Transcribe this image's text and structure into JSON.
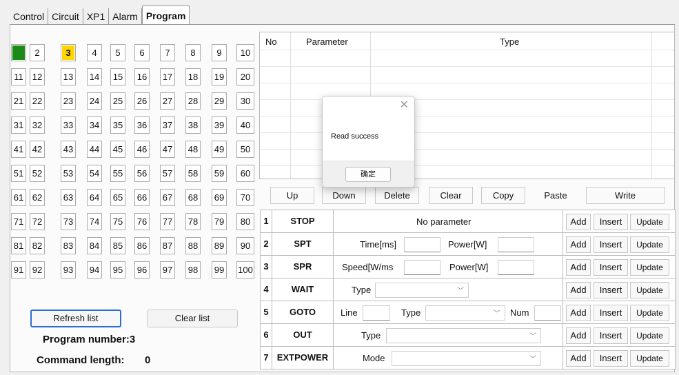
{
  "tabs": [
    {
      "label": "Control"
    },
    {
      "label": "Circuit"
    },
    {
      "label": "XP1"
    },
    {
      "label": "Alarm"
    },
    {
      "label": "Program"
    }
  ],
  "program_grid": {
    "active_green": "1",
    "selected_yellow": "3",
    "items": [
      "1",
      "2",
      "3",
      "4",
      "5",
      "6",
      "7",
      "8",
      "9",
      "10",
      "11",
      "12",
      "13",
      "14",
      "15",
      "16",
      "17",
      "18",
      "19",
      "20",
      "21",
      "22",
      "23",
      "24",
      "25",
      "26",
      "27",
      "28",
      "29",
      "30",
      "31",
      "32",
      "33",
      "34",
      "35",
      "36",
      "37",
      "38",
      "39",
      "40",
      "41",
      "42",
      "43",
      "44",
      "45",
      "46",
      "47",
      "48",
      "49",
      "50",
      "51",
      "52",
      "53",
      "54",
      "55",
      "56",
      "57",
      "58",
      "59",
      "60",
      "61",
      "62",
      "63",
      "64",
      "65",
      "66",
      "67",
      "68",
      "69",
      "70",
      "71",
      "72",
      "73",
      "74",
      "75",
      "76",
      "77",
      "78",
      "79",
      "80",
      "81",
      "82",
      "83",
      "84",
      "85",
      "86",
      "87",
      "88",
      "89",
      "90",
      "91",
      "92",
      "93",
      "94",
      "95",
      "96",
      "97",
      "98",
      "99",
      "100"
    ]
  },
  "left_buttons": {
    "refresh": "Refresh list",
    "clear": "Clear list"
  },
  "program_info": {
    "program_number_label": "Program number:",
    "program_number_value": "3",
    "command_length_label": "Command length:",
    "command_length_value": "0"
  },
  "list_table": {
    "headers": {
      "no": "No",
      "parameter": "Parameter",
      "type": "Type"
    }
  },
  "list_controls": [
    "Up",
    "Down",
    "Delete",
    "Clear",
    "Copy",
    "Paste",
    "Write"
  ],
  "commands": [
    {
      "num": "1",
      "name": "STOP",
      "params": {
        "text": "No parameter"
      }
    },
    {
      "num": "2",
      "name": "SPT",
      "params": {
        "label1": "Time[ms]",
        "label2": "Power[W]"
      }
    },
    {
      "num": "3",
      "name": "SPR",
      "params": {
        "label1": "Speed[W/ms",
        "label2": "Power[W]"
      }
    },
    {
      "num": "4",
      "name": "WAIT",
      "params": {
        "label1": "Type"
      }
    },
    {
      "num": "5",
      "name": "GOTO",
      "params": {
        "label1": "Line",
        "label2": "Type",
        "label3": "Num"
      }
    },
    {
      "num": "6",
      "name": "OUT",
      "params": {
        "label1": "Type"
      }
    },
    {
      "num": "7",
      "name": "EXTPOWER",
      "params": {
        "label1": "Mode"
      }
    }
  ],
  "action_labels": {
    "add": "Add",
    "insert": "Insert",
    "update": "Update"
  },
  "dialog": {
    "message": "Read success",
    "ok": "确定",
    "close_icon": "close-icon"
  },
  "colors": {
    "green": "#1b8a16",
    "yellow": "#ffd500",
    "accent_blue": "#2b6fd0"
  }
}
